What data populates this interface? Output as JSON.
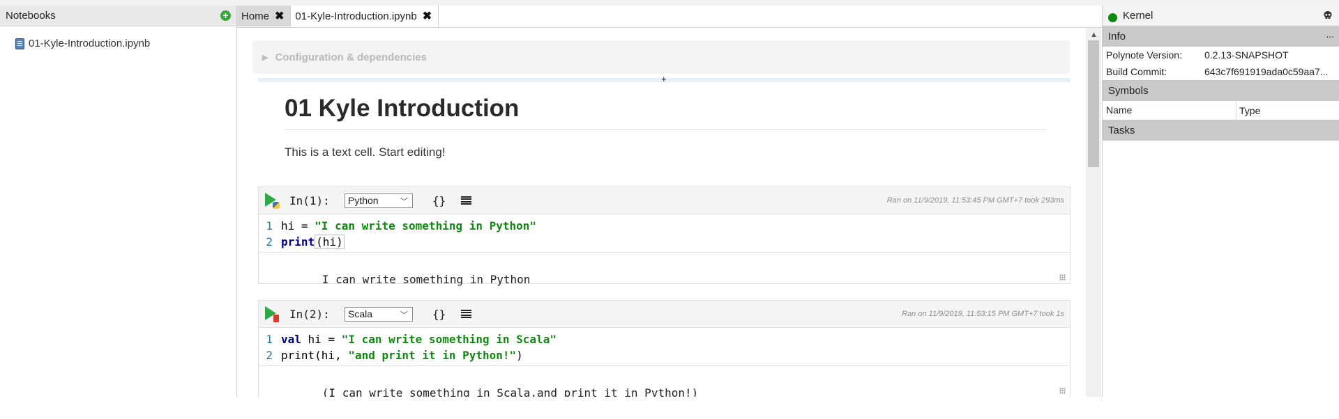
{
  "sidebar": {
    "title": "Notebooks",
    "add_icon": "plus-circle-icon",
    "items": [
      {
        "label": "01-Kyle-Introduction.ipynb",
        "icon": "notebook-icon"
      }
    ]
  },
  "tabs": [
    {
      "label": "Home",
      "close": "✖"
    },
    {
      "label": "01-Kyle-Introduction.ipynb",
      "close": "✖"
    }
  ],
  "notebook": {
    "config_label": "Configuration & dependencies",
    "insert_label": "+",
    "heading": "01 Kyle Introduction",
    "text": "This is a text cell. Start editing!",
    "cells": [
      {
        "prompt": "In(1):",
        "language": "Python",
        "braces": "{}",
        "ran": "Ran on 11/9/2019, 11:53:45 PM GMT+7 took 293ms",
        "line_numbers": [
          "1",
          "2"
        ],
        "output": "I can write something in Python"
      },
      {
        "prompt": "In(2):",
        "language": "Scala",
        "braces": "{}",
        "ran": "Ran on 11/9/2019, 11:53:15 PM GMT+7 took 1s",
        "line_numbers": [
          "1",
          "2"
        ],
        "output": "(I can write something in Scala,and print it in Python!)"
      }
    ]
  },
  "code": {
    "c1l1_a": "hi = ",
    "c1l1_b": "\"I can write something in Python\"",
    "c1l2_a": "print",
    "c1l2_b": "(hi)",
    "c2l1_a": "val",
    "c2l1_b": " hi = ",
    "c2l1_c": "\"I can write something in Scala\"",
    "c2l2_a": "print(hi, ",
    "c2l2_b": "\"and print it in Python!\"",
    "c2l2_c": ")"
  },
  "right_panel": {
    "kernel_label": "Kernel",
    "status_color": "#0c8a12",
    "info_label": "Info",
    "more": "...",
    "info": [
      {
        "key": "Polynote Version:",
        "value": "0.2.13-SNAPSHOT"
      },
      {
        "key": "Build Commit:",
        "value": "643c7f691919ada0c59aa7..."
      }
    ],
    "symbols_label": "Symbols",
    "symbols_cols": [
      "Name",
      "Type"
    ],
    "tasks_label": "Tasks"
  },
  "colors": {
    "accent_green": "#2fa84a",
    "keyword": "#00008b",
    "string": "#118811"
  }
}
